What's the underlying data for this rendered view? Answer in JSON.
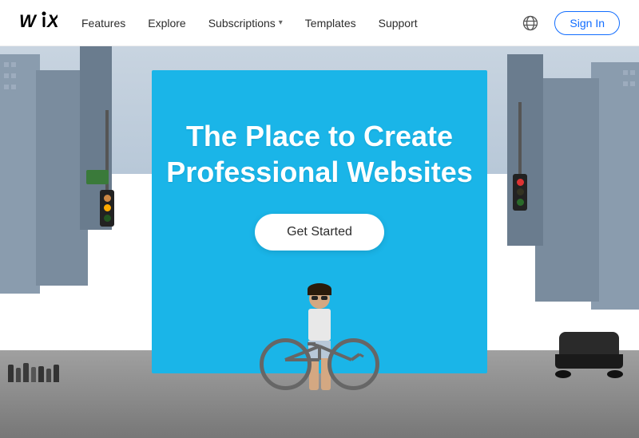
{
  "navbar": {
    "logo": "WiX",
    "links": [
      {
        "label": "Features",
        "has_dropdown": false
      },
      {
        "label": "Explore",
        "has_dropdown": false
      },
      {
        "label": "Subscriptions",
        "has_dropdown": true
      },
      {
        "label": "Templates",
        "has_dropdown": false
      },
      {
        "label": "Support",
        "has_dropdown": false
      }
    ],
    "sign_in_label": "Sign In"
  },
  "hero": {
    "billboard_title_line1": "The Place to Create",
    "billboard_title_line2": "Professional Websites",
    "cta_label": "Get Started",
    "billboard_color": "#1ab5e8"
  }
}
